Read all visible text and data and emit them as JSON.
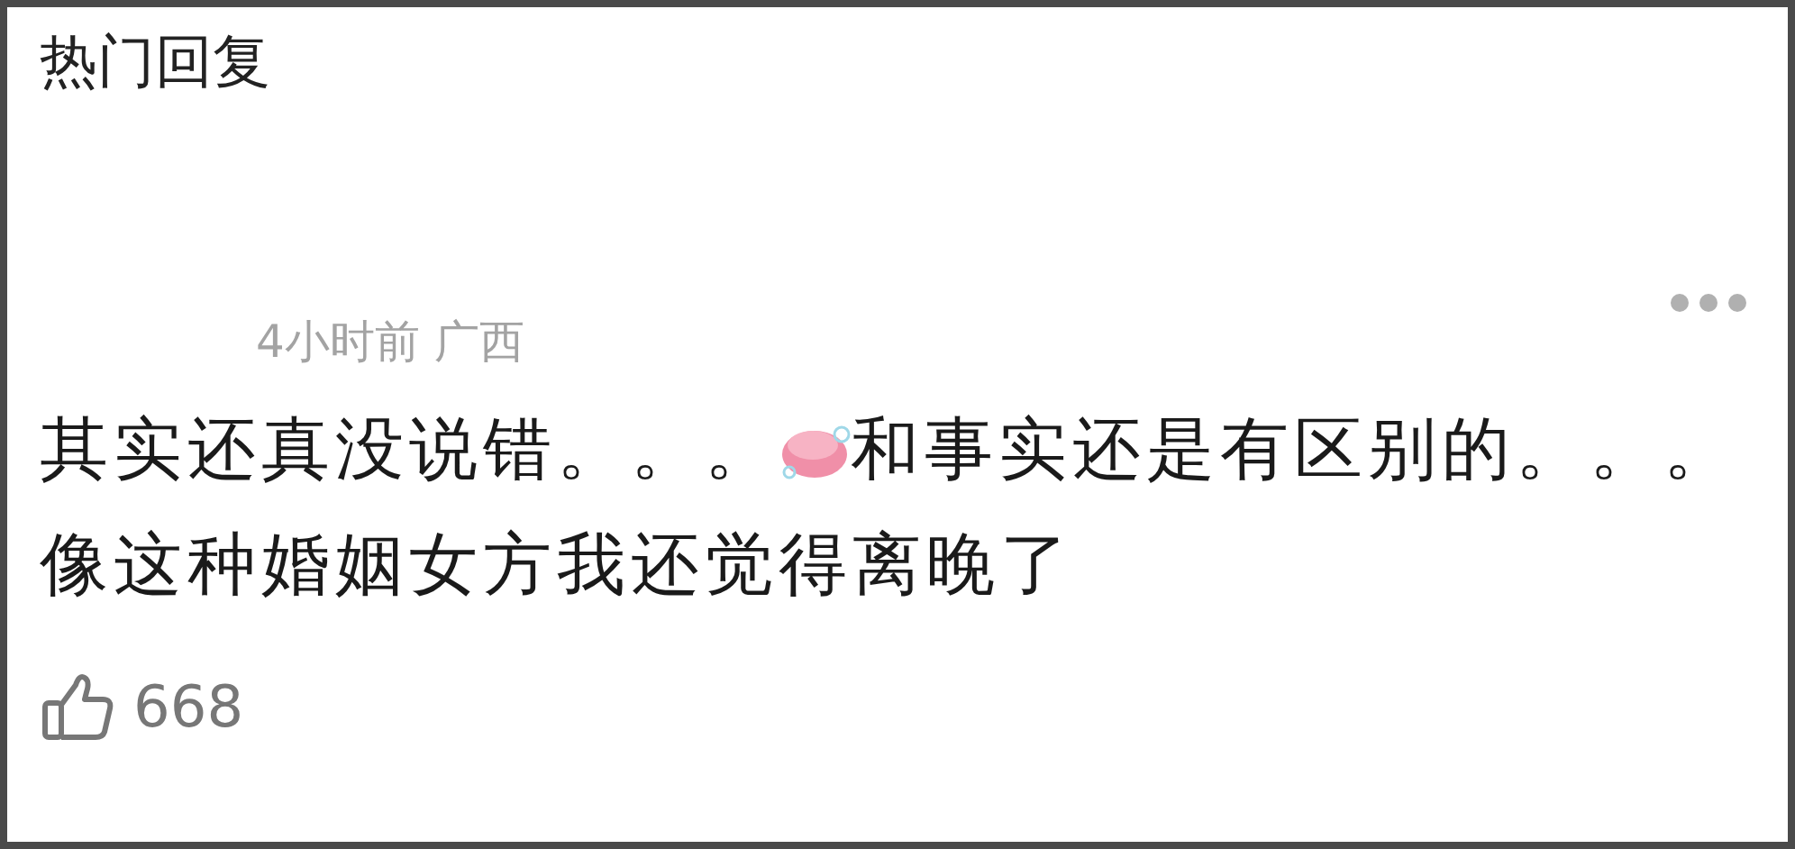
{
  "section_title": "热门回复",
  "comment": {
    "meta": "4小时前 广西",
    "lines": [
      {
        "parts": [
          {
            "kind": "text",
            "text": "其实还真没说错。。。"
          },
          {
            "kind": "emoji"
          },
          {
            "kind": "text",
            "text": "和事实还是有区别的。。。"
          }
        ]
      },
      {
        "parts": [
          {
            "kind": "text",
            "text": "像这种婚姻女方我还觉得离晚了"
          }
        ]
      }
    ],
    "likes": "668"
  }
}
